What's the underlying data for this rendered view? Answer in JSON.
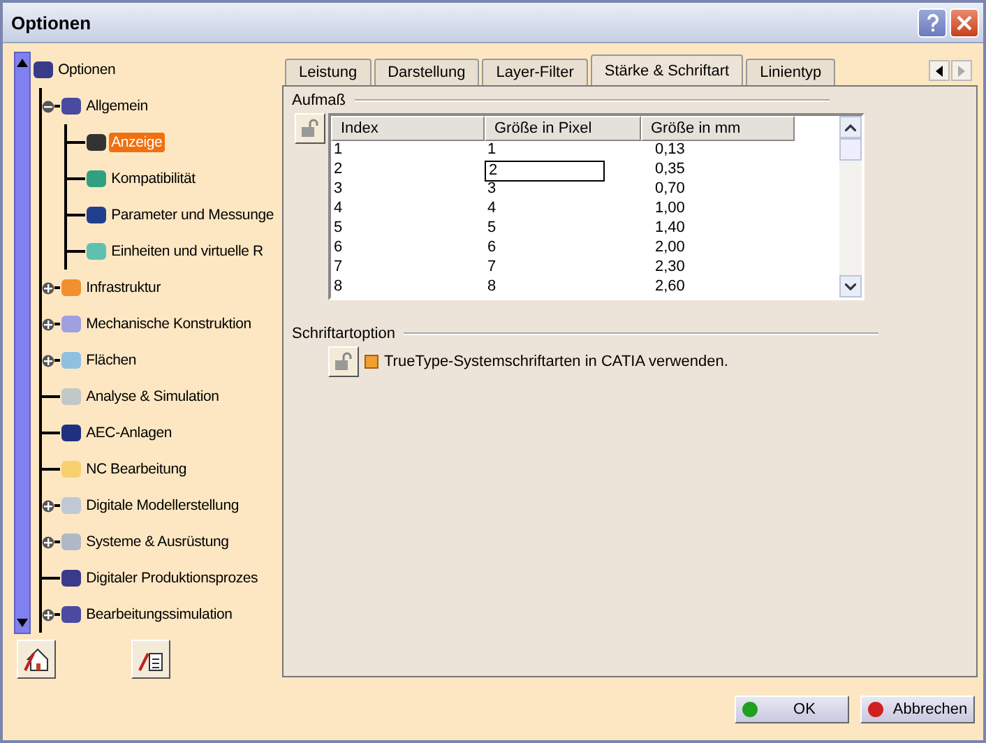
{
  "window": {
    "title": "Optionen"
  },
  "tree": {
    "label": "Optionen",
    "children": [
      {
        "label": "Allgemein",
        "expanded": true,
        "children": [
          {
            "label": "Anzeige",
            "selected": true
          },
          {
            "label": "Kompatibilität",
            "selected": false
          },
          {
            "label": "Parameter und Messunge",
            "selected": false
          },
          {
            "label": "Einheiten und virtuelle R",
            "selected": false
          }
        ]
      },
      {
        "label": "Infrastruktur",
        "expanded": false
      },
      {
        "label": "Mechanische Konstruktion",
        "expanded": false
      },
      {
        "label": "Flächen",
        "expanded": false
      },
      {
        "label": "Analyse & Simulation"
      },
      {
        "label": "AEC-Anlagen"
      },
      {
        "label": "NC Bearbeitung"
      },
      {
        "label": "Digitale Modellerstellung",
        "expanded": false
      },
      {
        "label": "Systeme & Ausrüstung",
        "expanded": false
      },
      {
        "label": "Digitaler Produktionsprozes"
      },
      {
        "label": "Bearbeitungssimulation",
        "expanded": false
      }
    ]
  },
  "tabs": [
    {
      "label": "Leistung",
      "selected": false
    },
    {
      "label": "Darstellung",
      "selected": false
    },
    {
      "label": "Layer-Filter",
      "selected": false
    },
    {
      "label": "Stärke & Schriftart",
      "selected": true
    },
    {
      "label": "Linientyp",
      "selected": false
    }
  ],
  "section_1": {
    "title": "Aufmaß",
    "columns": [
      "Index",
      "Größe in Pixel",
      "Größe in mm"
    ],
    "rows": [
      {
        "cells": [
          "1",
          "1",
          "0,13"
        ],
        "editing": false
      },
      {
        "cells": [
          "2",
          "2",
          "0,35"
        ],
        "editing": true
      },
      {
        "cells": [
          "3",
          "3",
          "0,70"
        ],
        "editing": false
      },
      {
        "cells": [
          "4",
          "4",
          "1,00"
        ],
        "editing": false
      },
      {
        "cells": [
          "5",
          "5",
          "1,40"
        ],
        "editing": false
      },
      {
        "cells": [
          "6",
          "6",
          "2,00"
        ],
        "editing": false
      },
      {
        "cells": [
          "7",
          "7",
          "2,30"
        ],
        "editing": false
      },
      {
        "cells": [
          "8",
          "8",
          "2,60"
        ],
        "editing": false
      }
    ]
  },
  "section_2": {
    "title": "Schriftartoption",
    "option": {
      "label": "TrueType-Systemschriftarten in CATIA verwenden.",
      "checked": true
    }
  },
  "buttons": [
    {
      "label": "OK",
      "kind": "ok"
    },
    {
      "label": "Abbrechen",
      "kind": "cancel"
    }
  ]
}
